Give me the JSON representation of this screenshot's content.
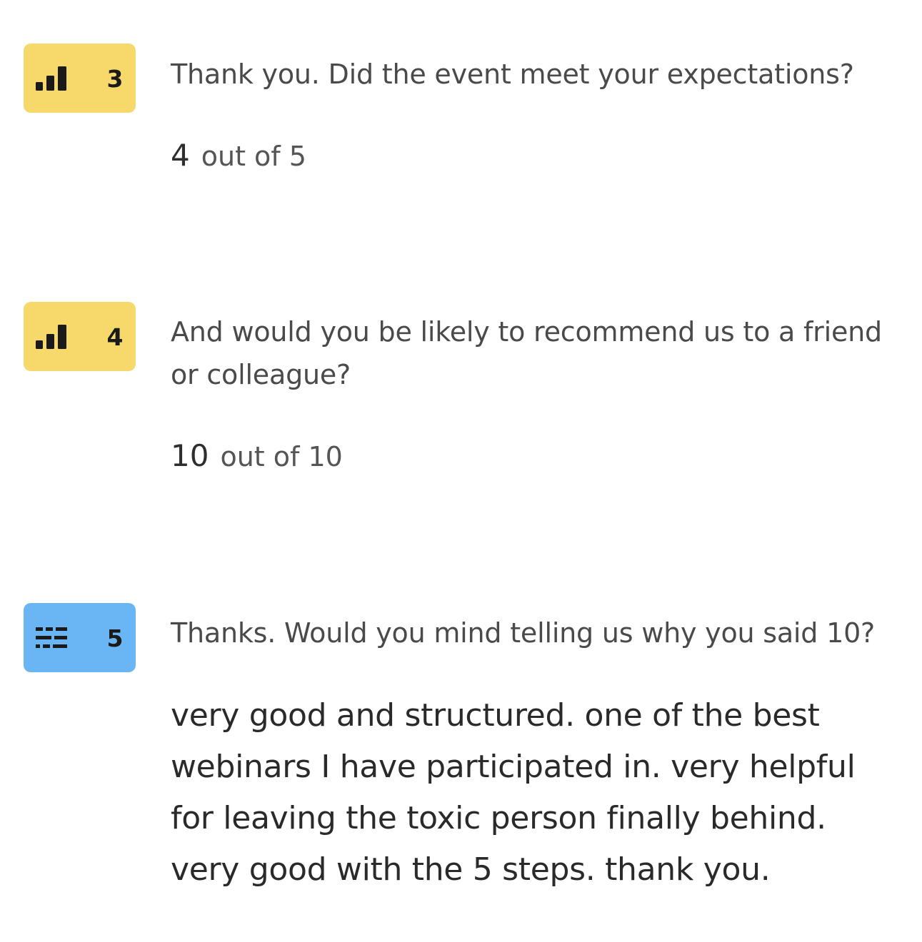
{
  "questions": [
    {
      "number": "3",
      "type_icon": "bar-chart-icon",
      "badge_color": "#f7d86b",
      "text": "Thank you. Did the event meet your expectations?",
      "answer_value": "4",
      "answer_scale": "out of 5"
    },
    {
      "number": "4",
      "type_icon": "bar-chart-icon",
      "badge_color": "#f7d86b",
      "text": "And would you be likely to recommend us to a friend or colleague?",
      "answer_value": "10",
      "answer_scale": "out of 10"
    },
    {
      "number": "5",
      "type_icon": "long-text-icon",
      "badge_color": "#6ab6f5",
      "text": "Thanks. Would you mind telling us why you said 10?",
      "answer_text": "very good and structured. one of the best webinars I have participated in. very helpful for leaving the toxic person finally behind. very good with the 5 steps. thank you."
    }
  ]
}
